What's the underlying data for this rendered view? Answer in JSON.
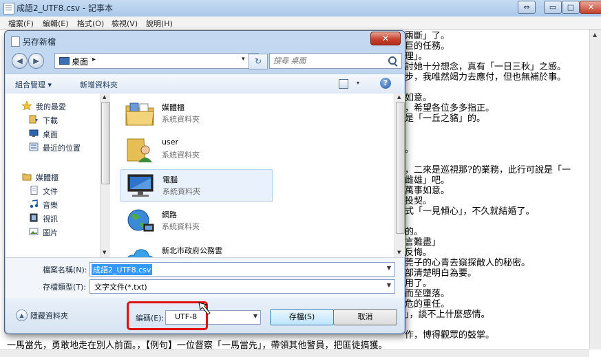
{
  "notepad": {
    "title": "成語2_UTF8.csv - 記事本",
    "caption_buttons": {
      "restore": "⇔",
      "minimize": "▭",
      "maximize": "□",
      "close": "✕"
    },
    "menu": [
      "檔案(F)",
      "編輯(E)",
      "格式(O)",
      "檢視(V)",
      "說明(H)"
    ],
    "lines": [
      "兩斷」了。",
      "巨的任務。",
      "理」。",
      "討她十分想念，真有「一日三秋」之感。",
      "步，我唯然竭力去應付，但也無補於事。",
      "",
      "如意。",
      "，希望各位多多指正。",
      "是「一丘之貉」的。",
      "",
      "",
      "。",
      "",
      "，二來是巡視那?的業務，此行可說是「一",
      "雌雄」吧。",
      "萬事如意。",
      "投契。",
      "式「一見傾心」，不久就結婚了。",
      "",
      "的。",
      "言難盡」",
      "反悔。",
      "莞子的心青去窺探敵人的秘密。",
      "部清楚明白為要。",
      "用了。",
      "而至墮落。",
      "危的重任。",
      "」，談不上什麼感情。",
      "",
      "作，博得觀眾的鼓掌。",
      "一馬當先，勇敢地走在別人前面。，【例句】一位督察「一馬當先」，帶領其他警員，把匪徒搞獲。"
    ]
  },
  "dialog": {
    "title": "另存新檔",
    "close_label": "✕",
    "address": {
      "location": "桌面",
      "chevron": "▸",
      "dropdown": "▾"
    },
    "back_label": "◀",
    "forward_label": "▶",
    "refresh_label": "↻",
    "search_placeholder": "搜尋 桌面",
    "toolbar": {
      "organize": "組合管理 ▾",
      "new_folder": "新增資料夾",
      "views_drop": "▾",
      "help": "?"
    },
    "nav": {
      "favorites": "我的最愛",
      "downloads": "下載",
      "desktop": "桌面",
      "recent": "最近的位置",
      "libraries": "媒體櫃",
      "documents": "文件",
      "music": "音樂",
      "videos": "視訊",
      "pictures": "圖片"
    },
    "files": [
      {
        "name": "媒體櫃",
        "type": "系統資料夾"
      },
      {
        "name": "user",
        "type": "系統資料夾"
      },
      {
        "name": "電腦",
        "type": "系統資料夾"
      },
      {
        "name": "網路",
        "type": "系統資料夾"
      },
      {
        "name": "新北市政府公務雲",
        "type": "系統資料夾"
      }
    ],
    "filename_label": "檔案名稱(N):",
    "filename_value": "成語2_UTF8.csv",
    "filetype_label": "存檔類型(T):",
    "filetype_value": "文字文件(*.txt)",
    "hide_folders": "隱藏資料夾",
    "encoding_label": "編碼(E):",
    "encoding_value": "UTF-8",
    "save_button": "存檔(S)",
    "cancel_button": "取消"
  },
  "colors": {
    "highlight_circle": "#e01010",
    "selection": "#3399ff"
  }
}
